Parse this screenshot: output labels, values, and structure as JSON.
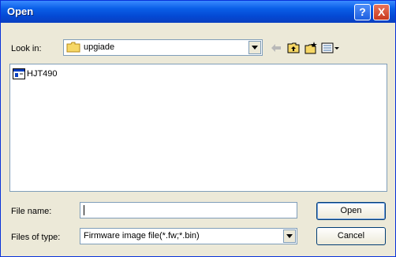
{
  "window": {
    "title": "Open"
  },
  "titlebar": {
    "help_glyph": "?",
    "close_glyph": "X"
  },
  "look_in": {
    "label": "Look in:",
    "value": "upgiade"
  },
  "files": [
    {
      "name": "HJT490",
      "icon": "application-icon"
    }
  ],
  "file_name": {
    "label": "File name:",
    "value": ""
  },
  "files_of_type": {
    "label": "Files of type:",
    "value": "Firmware image file(*.fw;*.bin)"
  },
  "buttons": {
    "open": "Open",
    "cancel": "Cancel"
  },
  "icons": {
    "toolbar": [
      "back-arrow-icon",
      "up-folder-icon",
      "new-folder-icon",
      "view-menu-icon"
    ]
  }
}
